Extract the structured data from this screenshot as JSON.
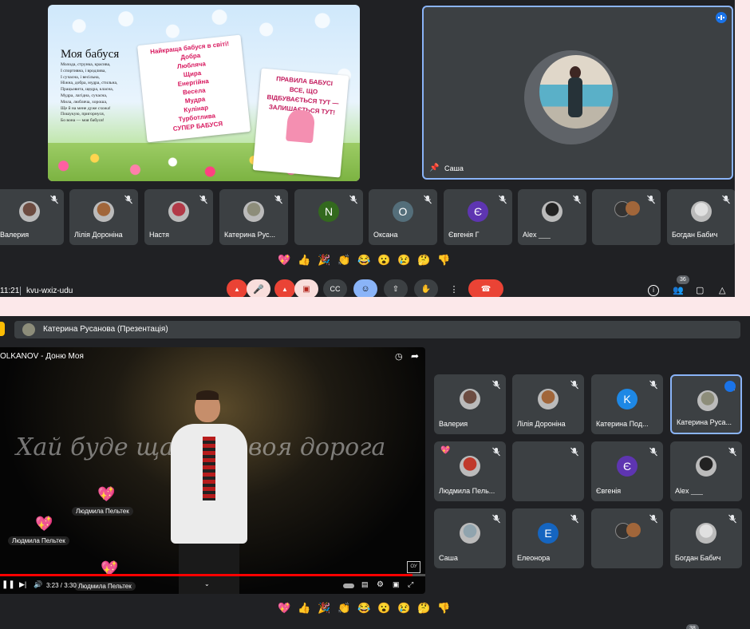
{
  "top": {
    "slide": {
      "title": "Моя бабуся",
      "poem": [
        "Молода, струнка, красива,",
        "І спортивна, і вродлива,",
        "І сучасна, і весільна,",
        "Ніжна, добра, мудра, стильна,",
        "Працьовита, щедра, класна,",
        "Мудра, лагідна, сучасна,",
        "Мила, люблячa, хороша,",
        "Ще й на мене дуже схожа!",
        "Пошукую, пригорнуся,",
        "Бо вона — моя бабуся!"
      ],
      "card1_lines": [
        "Найкраща бабуся в світі!",
        "Добра",
        "Любляча",
        "Щира",
        "Енергійна",
        "Весела",
        "Мудра",
        "Кулінар",
        "Турботлива",
        "СУПЕР БАБУСЯ"
      ],
      "card2_lines": [
        "ПРАВИЛА БАБУСІ",
        "ВСЕ, ЩО ВІДБУВАЄТЬСЯ ТУТ — ЗАЛИШАЄТЬСЯ ТУТ!"
      ]
    },
    "pinned": {
      "name": "Саша"
    },
    "participants": [
      {
        "name": "Валерия",
        "avatar": "photo",
        "color": "#6d4c41"
      },
      {
        "name": "Лілія Дороніна",
        "avatar": "photo",
        "color": "#a1663a"
      },
      {
        "name": "Настя",
        "avatar": "photo",
        "color": "#b23a48"
      },
      {
        "name": "Катерина Рус...",
        "avatar": "photo",
        "color": "#8d8d7a"
      },
      {
        "name": "",
        "avatar": "N",
        "color": "#33691e"
      },
      {
        "name": "Оксана",
        "avatar": "О",
        "color": "#546e7a"
      },
      {
        "name": "Євгенія Г",
        "avatar": "Є",
        "color": "#5e35b1"
      },
      {
        "name": "Alex ___",
        "avatar": "photo",
        "color": "#222222"
      },
      {
        "name": "",
        "avatar": "photo2",
        "color": "#444444"
      },
      {
        "name": "Богдан Бабич",
        "avatar": "photo",
        "color": "#e0e0e0"
      }
    ],
    "reactions": [
      "💖",
      "👍",
      "🎉",
      "👏",
      "😂",
      "😮",
      "😢",
      "🤔",
      "👎"
    ],
    "meeting_time": "11:21",
    "meeting_code": "kvu-wxiz-udu",
    "people_count": "36"
  },
  "bottom": {
    "presenter_bar": "Катерина Русанова (Презентація)",
    "video": {
      "title": "OLKANOV - Доню Моя",
      "overlay_text": "Хай буде щас     твоя дорога",
      "time": "3:23 / 3:30",
      "progress": 0.97,
      "reaction_labels": [
        "Людмила Пельтек",
        "Людмила Пельтек",
        "Людмила Пельтек"
      ]
    },
    "participants": [
      {
        "name": "Валерия",
        "avatar": "photo",
        "color": "#6d4c41"
      },
      {
        "name": "Лілія Дороніна",
        "avatar": "photo",
        "color": "#a1663a"
      },
      {
        "name": "Катерина Под...",
        "avatar": "K",
        "color": "#1e88e5"
      },
      {
        "name": "Катерина Руса...",
        "avatar": "photo",
        "color": "#8d8d7a"
      },
      {
        "name": "Людмила Пель...",
        "avatar": "photo",
        "color": "#c0392b"
      },
      {
        "name": "",
        "avatar": "none",
        "color": "#3c4043"
      },
      {
        "name": "Євгенія",
        "avatar": "Є",
        "color": "#5e35b1"
      },
      {
        "name": "Alex ___",
        "avatar": "photo",
        "color": "#222222"
      },
      {
        "name": "Саша",
        "avatar": "photo",
        "color": "#90a4ae"
      },
      {
        "name": "Елеонора",
        "avatar": "E",
        "color": "#1565c0"
      },
      {
        "name": "",
        "avatar": "photo2",
        "color": "#444444"
      },
      {
        "name": "Богдан Бабич",
        "avatar": "photo",
        "color": "#e0e0e0"
      }
    ],
    "reactions": [
      "💖",
      "👍",
      "🎉",
      "👏",
      "😂",
      "😮",
      "😢",
      "🤔",
      "👎"
    ],
    "people_count": "38"
  }
}
